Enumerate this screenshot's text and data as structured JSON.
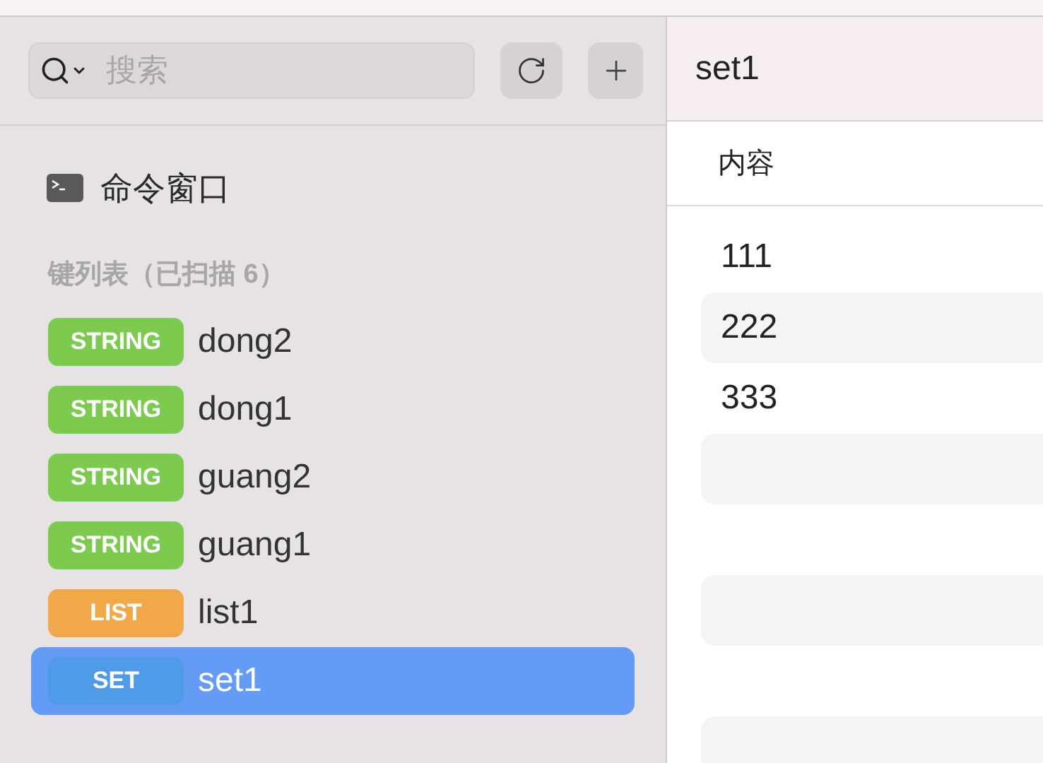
{
  "sidebar": {
    "search": {
      "placeholder": "搜索"
    },
    "command_window": {
      "label": "命令窗口"
    },
    "section_title": "键列表（已扫描 6）",
    "keys": [
      {
        "type": "STRING",
        "kind": "string",
        "name": "dong2",
        "selected": false
      },
      {
        "type": "STRING",
        "kind": "string",
        "name": "dong1",
        "selected": false
      },
      {
        "type": "STRING",
        "kind": "string",
        "name": "guang2",
        "selected": false
      },
      {
        "type": "STRING",
        "kind": "string",
        "name": "guang1",
        "selected": false
      },
      {
        "type": "LIST",
        "kind": "list",
        "name": "list1",
        "selected": false
      },
      {
        "type": "SET",
        "kind": "set",
        "name": "set1",
        "selected": true
      }
    ]
  },
  "detail": {
    "title": "set1",
    "table": {
      "columns": [
        "内容"
      ],
      "rows": [
        "111",
        "222",
        "333"
      ]
    }
  }
}
